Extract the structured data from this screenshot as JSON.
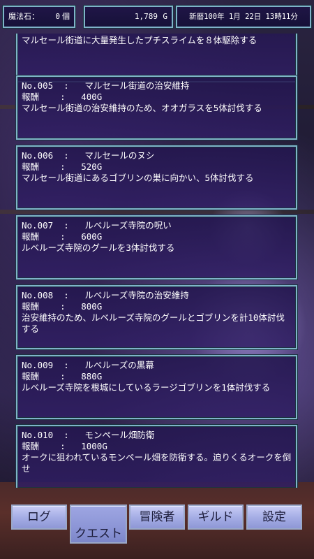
{
  "status": {
    "magic_label": "魔法石：",
    "magic_value": "0",
    "magic_unit": "個",
    "gold_value": "1,789",
    "gold_unit": "G",
    "date": "新暦100年 1月 22日 13時11分"
  },
  "quests": [
    {
      "partial": true,
      "desc": "マルセール街道に大量発生したプチスライムを８体駆除する"
    },
    {
      "no": "No.005",
      "title": "マルセール街道の治安維持",
      "reward_label": "報酬",
      "reward": "400G",
      "desc": "マルセール街道の治安維持のため、オオガラスを5体討伐する"
    },
    {
      "no": "No.006",
      "title": "マルセールのヌシ",
      "reward_label": "報酬",
      "reward": "520G",
      "desc": "マルセール街道にあるゴブリンの巣に向かい、5体討伐する"
    },
    {
      "no": "No.007",
      "title": "ルベルーズ寺院の呪い",
      "reward_label": "報酬",
      "reward": "600G",
      "desc": "ルベルーズ寺院のグールを3体討伐する"
    },
    {
      "no": "No.008",
      "title": "ルベルーズ寺院の治安維持",
      "reward_label": "報酬",
      "reward": "800G",
      "desc": "治安維持のため、ルベルーズ寺院のグールとゴブリンを計10体討伐する"
    },
    {
      "no": "No.009",
      "title": "ルベルーズの黒幕",
      "reward_label": "報酬",
      "reward": "880G",
      "desc": "ルベルーズ寺院を根城にしているラージゴブリンを1体討伐する"
    },
    {
      "no": "No.010",
      "title": "モンペール畑防衛",
      "reward_label": "報酬",
      "reward": "1000G",
      "desc": "オークに狙われているモンペール畑を防衛する。迫りくるオークを倒せ"
    }
  ],
  "tabs": {
    "log": "ログ",
    "quest": "クエスト",
    "adventurer": "冒険者",
    "guild": "ギルド",
    "settings": "設定",
    "active": "quest"
  }
}
